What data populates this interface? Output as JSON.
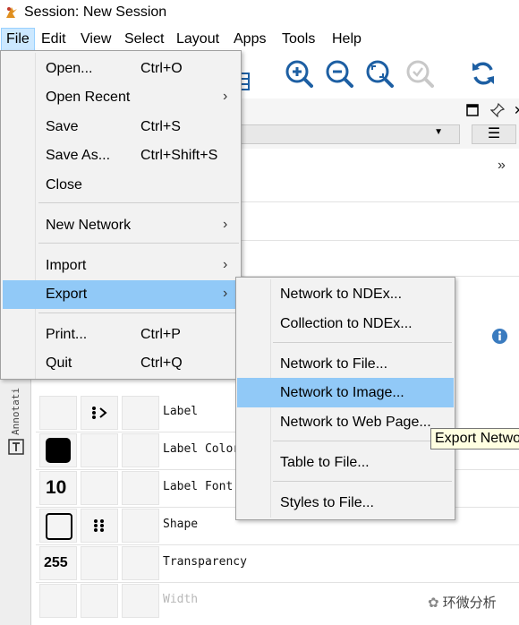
{
  "window": {
    "title": "Session: New Session"
  },
  "menubar": {
    "items": [
      "File",
      "Edit",
      "View",
      "Select",
      "Layout",
      "Apps",
      "Tools",
      "Help"
    ]
  },
  "toolbar": {
    "icons": [
      "zoom-in-icon",
      "zoom-out-icon",
      "zoom-fit-icon",
      "zoom-selected-icon",
      "refresh-icon"
    ]
  },
  "file_menu": {
    "items": [
      {
        "label": "Open...",
        "shortcut": "Ctrl+O"
      },
      {
        "label": "Open Recent",
        "submenu": true
      },
      {
        "label": "Save",
        "shortcut": "Ctrl+S"
      },
      {
        "label": "Save As...",
        "shortcut": "Ctrl+Shift+S"
      },
      {
        "label": "Close"
      },
      {
        "label": "New Network",
        "submenu": true
      },
      {
        "label": "Import",
        "submenu": true
      },
      {
        "label": "Export",
        "submenu": true,
        "highlighted": true
      },
      {
        "label": "Print...",
        "shortcut": "Ctrl+P"
      },
      {
        "label": "Quit",
        "shortcut": "Ctrl+Q"
      }
    ]
  },
  "export_menu": {
    "items": [
      {
        "label": "Network to NDEx..."
      },
      {
        "label": "Collection to NDEx..."
      },
      {
        "label": "Network to File..."
      },
      {
        "label": "Network to Image...",
        "highlighted": true
      },
      {
        "label": "Network to Web Page..."
      },
      {
        "label": "Table to File..."
      },
      {
        "label": "Styles to File..."
      }
    ]
  },
  "tooltip": {
    "text": "Export Netwo"
  },
  "side_tab": {
    "label": "Annotati"
  },
  "properties": {
    "rows": [
      {
        "label": "Label",
        "value": ""
      },
      {
        "label": "Label Color",
        "value": ""
      },
      {
        "label": "Label Font",
        "value": "10"
      },
      {
        "label": "Shape",
        "value": ""
      },
      {
        "label": "Transparency",
        "value": "255"
      },
      {
        "label": "Width",
        "value": ""
      }
    ]
  },
  "watermark": {
    "text": "环微分析"
  },
  "colors": {
    "highlight": "#91c9f7",
    "menu_bg": "#f2f2f2",
    "toolbar_icon": "#1d5fa3",
    "info_icon": "#3a7bbf"
  }
}
